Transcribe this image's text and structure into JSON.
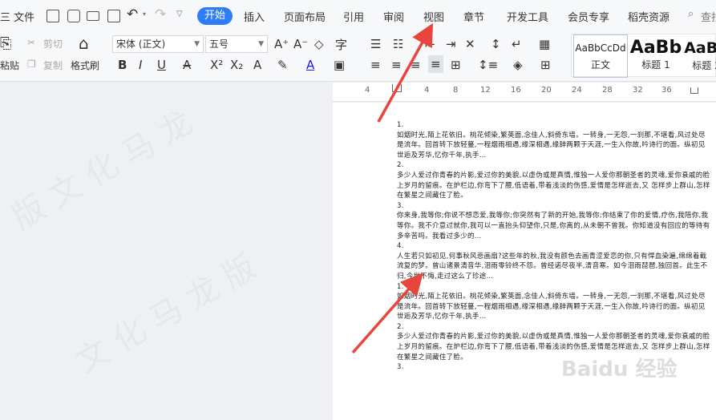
{
  "menu": {
    "file": "三 文件",
    "tabs": [
      "开始",
      "插入",
      "页面布局",
      "引用",
      "审阅",
      "视图",
      "章节",
      "开发工具",
      "会员专享",
      "稻壳资源"
    ],
    "search": "查找"
  },
  "ribbon": {
    "paste": "粘贴",
    "cut": "剪切",
    "copy": "复制",
    "format_painter": "格式刷",
    "font_name": "宋体 (正文)",
    "font_size": "五号",
    "styles": [
      {
        "preview": "AaBbCcDd",
        "label": "正文"
      },
      {
        "preview": "AaBb",
        "label": "标题 1"
      },
      {
        "preview": "AaBb",
        "label": "标题 2"
      }
    ]
  },
  "ruler": {
    "ticks": [
      "4",
      "4",
      "8",
      "12",
      "16",
      "20",
      "24",
      "28",
      "32",
      "36"
    ]
  },
  "document": {
    "paragraphs": [
      {
        "num": "1.",
        "text": "如烟时光,陌上花依旧。桃花倾染,繁英面,念佳人,斜倚东墙。一转身,一无怨,一刹那,不堪看,风过处尽是流年。回首转下放轻蔓,一程烟雨相遇,缘深相遇,缘辞两颗于天涯,一生入你故,吟诗行的面。纵初见世逅及芳华,忆你千年,执手…"
      },
      {
        "num": "2.",
        "text": "多少人爱过你青春的片影,爱过你的美貌,以虚伪或是真情,惟独一人爱你那朝圣者的灵魂,爱你衰戚的脸上岁月的留痕。在炉栏边,你弯下了腰,低语着,带着浅淡的伤感,爱情是怎样逝去,又 怎样步上群山,怎样在繁星之间藏住了脸。"
      },
      {
        "num": "3.",
        "text": "你来身,我等你;你说不想恋爱,我等你;你突然有了新的开始,我等你;你结束了你的爱情,疗伤,我陪你,我等你。我不介意过就你,我可以一直抬头仰望你,只是,你离的,从未朝不曾我。你知道没有回应的等待有多辛苦吗。我看过多少的…"
      },
      {
        "num": "4.",
        "text": "人生若只如初见,何事秋风悲画扇?这些年的秋,我没有颜色去画青涩爱恋的你,只有悍血染遍,绵绵着截流复的梦。曾山诸景清音华,泪雨零铃终不怨。曾经诺尽夜半,清音寒。如今泪雨琵琶,独回首。此生不归,今世不悔,走过这么了珍途…"
      },
      {
        "num": "1.",
        "text": "如烟时光,陌上花依旧。桃花倾染,繁英面,念佳人,斜倚东墙。一转身,一无怨,一刹那,不堪看,风过处尽是流年。回首转下放轻蔓,一程烟雨相遇,缘深相遇,缘辞两颗于天涯,一生入你故,吟诗行的面。纵初见世逅及芳华,忆你千年,执手…"
      },
      {
        "num": "2.",
        "text": "多少人爱过你青春的片影,爱过你的美貌,以虚伪或是真情,惟独一人爱你那朝圣者的灵魂,爱你衰戚的脸上岁月的留痕。在炉栏边,你弯下了腰,低语着,带着浅淡的伤感,爱情是怎样逝去,又 怎样步上群山,怎样在繁星之间藏住了脸。"
      },
      {
        "num": "3.",
        "text": ""
      }
    ]
  },
  "watermark": "Baidu 经验",
  "colors": {
    "accent": "#2e7cf6",
    "arrow": "#e8453c"
  }
}
